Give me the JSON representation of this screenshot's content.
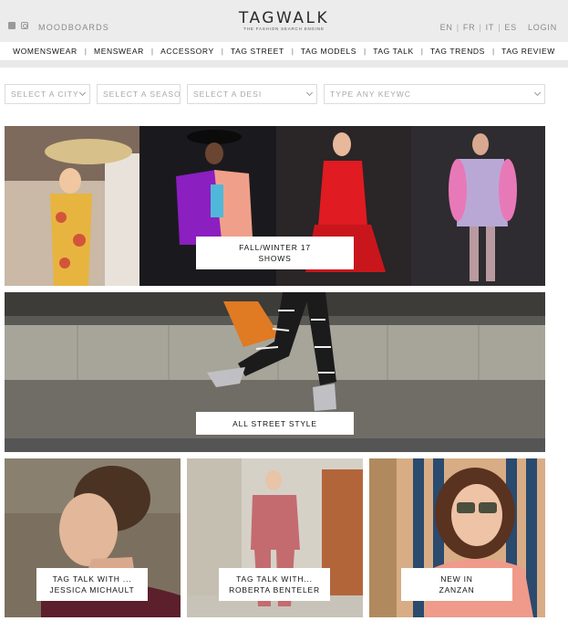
{
  "header": {
    "moodboards": "MOODBOARDS",
    "logo": "TAGWALK",
    "tagline": "THE FASHION SEARCH ENGINE",
    "languages": [
      "EN",
      "FR",
      "IT",
      "ES"
    ],
    "separator": "|",
    "login": "LOGIN",
    "social_icons": [
      "facebook-icon",
      "instagram-icon"
    ]
  },
  "nav": {
    "items": [
      "WOMENSWEAR",
      "MENSWEAR",
      "ACCESSORY",
      "TAG STREET",
      "TAG MODELS",
      "TAG TALK",
      "TAG TRENDS",
      "TAG REVIEW"
    ],
    "separator": "|"
  },
  "filters": {
    "city": "SELECT A CITY",
    "season": "SELECT A SEASON",
    "designer": "SELECT A DESI",
    "keyword": "TYPE ANY KEYWC"
  },
  "tiles": {
    "shows": {
      "line1": "FALL/WINTER 17",
      "line2": "SHOWS"
    },
    "street": {
      "line1": "ALL STREET STYLE"
    },
    "talk1": {
      "line1": "TAG TALK WITH ...",
      "line2": "JESSICA MICHAULT"
    },
    "talk2": {
      "line1": "TAG TALK WITH...",
      "line2": "ROBERTA BENTELER"
    },
    "newin": {
      "line1": "NEW IN",
      "line2": "ZANZAN"
    }
  },
  "colors": {
    "topbar_bg": "#ececec",
    "text_dark": "#111111",
    "text_muted": "#8a8a8a"
  }
}
